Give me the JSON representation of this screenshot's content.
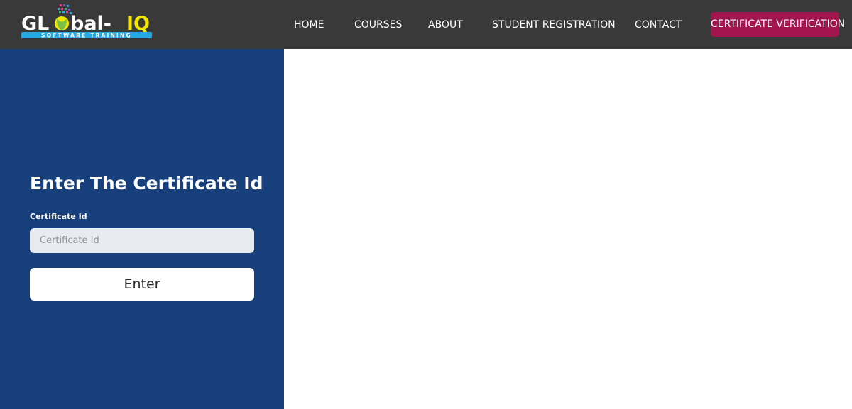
{
  "header": {
    "logo": {
      "brand_text": "GL bal-IQ",
      "tagline": "SOFTWARE TRAINING"
    },
    "nav": {
      "home": "HOME",
      "courses": "COURSES",
      "about": "ABOUT",
      "registration": "STUDENT REGISTRATION",
      "contact": "CONTACT",
      "certificate_verification": "CERTIFICATE VERIFICATION"
    }
  },
  "verification_form": {
    "title": "Enter The Certificate Id",
    "field_label": "Certificate Id",
    "input_placeholder": "Certificate Id",
    "input_value": "",
    "submit_label": "Enter"
  },
  "colors": {
    "navbar_bg": "#393939",
    "cta_bg": "#a3154f",
    "panel_bg": "#173f7c",
    "logo_text": "#ffffff",
    "logo_accent_yellow": "#f2e600",
    "logo_tagline_bg": "#2aa7df"
  }
}
